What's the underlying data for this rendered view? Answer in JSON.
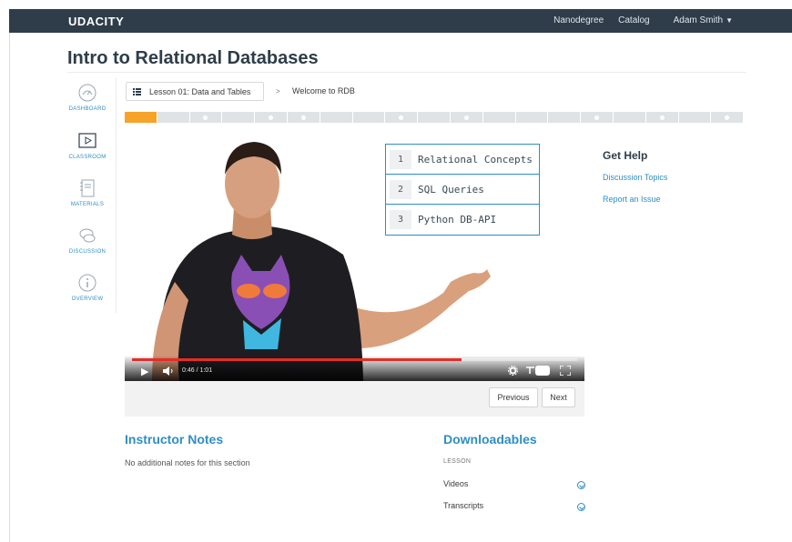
{
  "nav": {
    "brand": "UDACITY",
    "links": [
      "Nanodegree",
      "Catalog"
    ],
    "user": "Adam Smith"
  },
  "page": {
    "title": "Intro to Relational Databases"
  },
  "sidebar": {
    "items": [
      {
        "label": "DASHBOARD",
        "icon": "dashboard-icon"
      },
      {
        "label": "CLASSROOM",
        "icon": "play-box-icon"
      },
      {
        "label": "MATERIALS",
        "icon": "notebook-icon"
      },
      {
        "label": "DISCUSSION",
        "icon": "chat-bubbles-icon"
      },
      {
        "label": "OVERVIEW",
        "icon": "info-circle-icon"
      }
    ]
  },
  "breadcrumb": {
    "lesson": "Lesson 01: Data and Tables",
    "separator": ">",
    "current": "Welcome to RDB"
  },
  "progress": {
    "segments": 19,
    "completed": 1,
    "accent": "#f6a32a"
  },
  "video": {
    "topics": [
      {
        "num": "1",
        "label": "Relational Concepts"
      },
      {
        "num": "2",
        "label": "SQL Queries"
      },
      {
        "num": "3",
        "label": "Python DB-API"
      }
    ],
    "time": "0:46 / 1:01",
    "played_fraction": 0.74
  },
  "buttons": {
    "previous": "Previous",
    "next": "Next"
  },
  "help": {
    "title": "Get Help",
    "links": [
      "Discussion Topics",
      "Report an Issue"
    ]
  },
  "notes": {
    "title": "Instructor Notes",
    "text": "No additional notes for this section"
  },
  "downloads": {
    "title": "Downloadables",
    "section_label": "LESSON",
    "items": [
      "Videos",
      "Transcripts"
    ]
  },
  "colors": {
    "navbar": "#2e3d49",
    "link": "#2e8ec4",
    "accent": "#f6a32a",
    "scrub": "#e52d27"
  }
}
